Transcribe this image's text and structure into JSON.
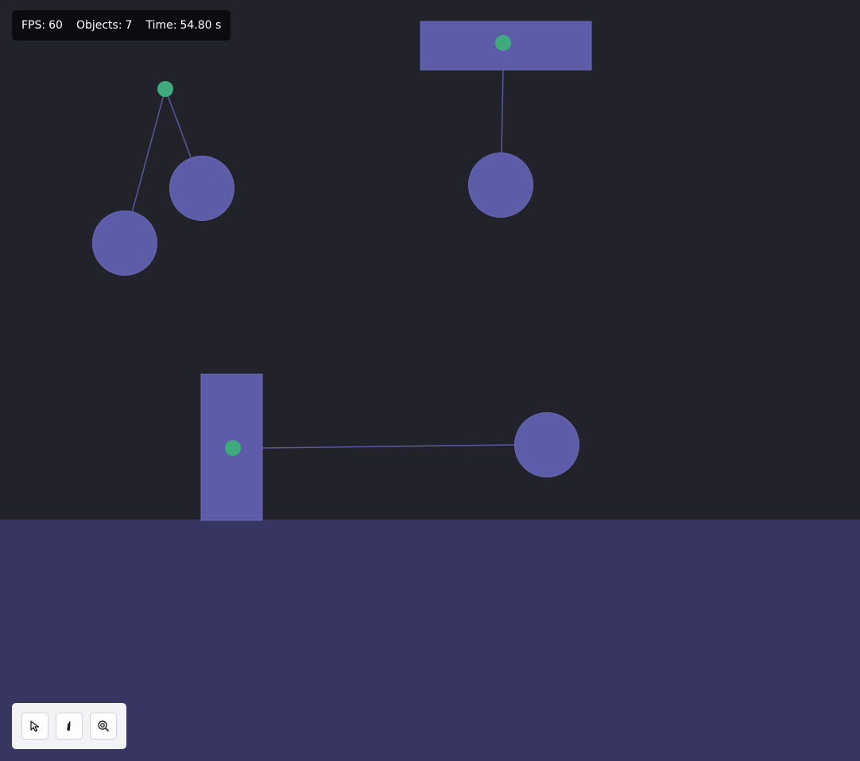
{
  "hud": {
    "fps_label": "FPS:",
    "fps_value": "60",
    "objects_label": "Objects:",
    "objects_value": "7",
    "time_label": "Time:",
    "time_value": "54.80 s"
  },
  "toolbar": {
    "tools": [
      {
        "name": "select",
        "icon": "cursor-arrow-icon"
      },
      {
        "name": "grab",
        "icon": "hand-icon"
      },
      {
        "name": "zoom",
        "icon": "zoom-icon"
      }
    ]
  },
  "colors": {
    "background": "#22222b",
    "ground": "#373662",
    "body": "#5d5ca8",
    "body_stroke": "#6b6ab8",
    "anchor": "#3faa7c",
    "constraint": "#5a59a0",
    "hud_bg": "#0c0c10",
    "toolbar_bg": "#f3f3f6"
  }
}
